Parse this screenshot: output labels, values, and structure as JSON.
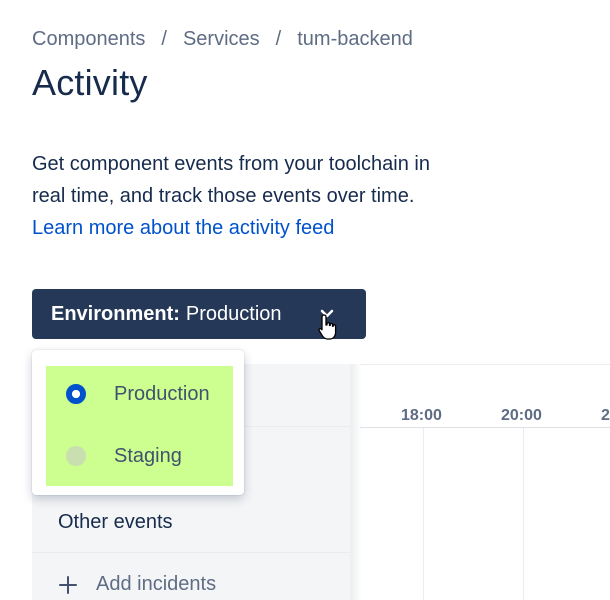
{
  "breadcrumb": {
    "items": [
      "Components",
      "Services",
      "tum-backend"
    ],
    "separator": "/"
  },
  "page": {
    "title": "Activity",
    "description": "Get component events from your toolchain in real time, and track those events over time. ",
    "learn_more_link": "Learn more about the activity feed"
  },
  "environment_button": {
    "label": "Environment:",
    "value": "Production",
    "icon": "chevron-down-icon"
  },
  "dropdown": {
    "options": [
      {
        "label": "Production",
        "selected": true
      },
      {
        "label": "Staging",
        "selected": false
      }
    ],
    "highlight_color": "#ccff90"
  },
  "sidebar": {
    "other_events": "Other events",
    "add_incidents": "Add incidents"
  },
  "timeline": {
    "ticks": [
      "18:00",
      "20:00",
      "2"
    ]
  },
  "colors": {
    "button_bg": "#253858",
    "link": "#0052cc",
    "radio_checked": "#0052cc"
  }
}
